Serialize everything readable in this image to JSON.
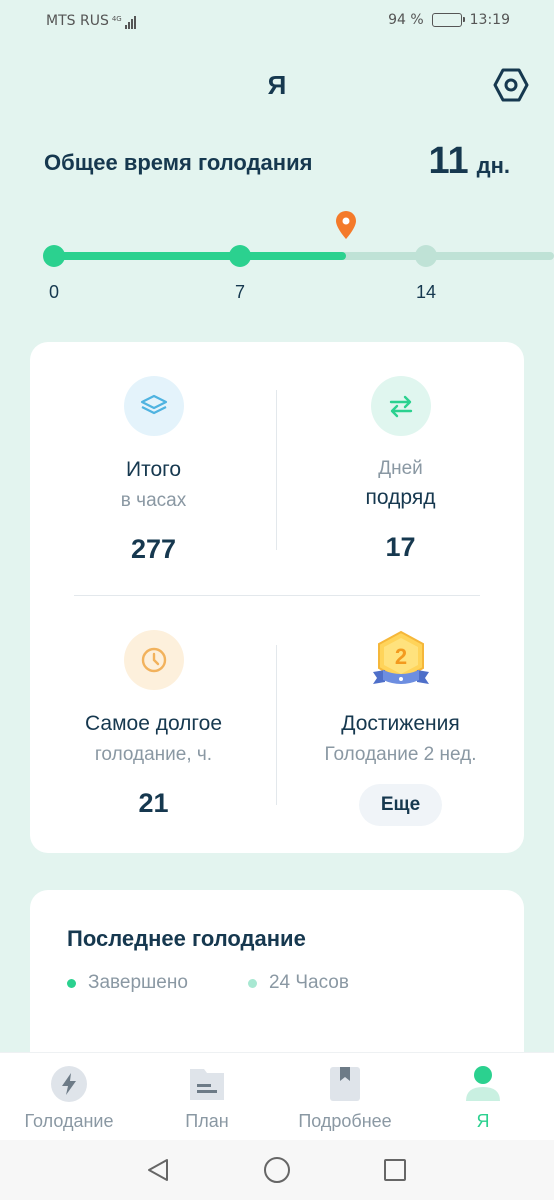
{
  "status_bar": {
    "carrier": "MTS RUS",
    "network": "4G",
    "battery": "94 %",
    "time": "13:19"
  },
  "header": {
    "title": "Я",
    "settings_icon": "hexagon-settings-icon"
  },
  "summary": {
    "label": "Общее время голодания",
    "value": "11",
    "unit": "дн."
  },
  "timeline": {
    "ticks": [
      "0",
      "7",
      "14"
    ],
    "progress_days": 11,
    "max_days": 21,
    "colors": {
      "done": "#2bd18f",
      "future": "#bfe2d6",
      "marker": "#f47a2a"
    }
  },
  "stats": {
    "total": {
      "title": "Итого",
      "subtitle": "в часах",
      "value": "277",
      "icon": "layers-icon"
    },
    "streak": {
      "muted": "Дней",
      "title": "подряд",
      "value": "17",
      "icon": "swap-arrows-icon"
    },
    "longest": {
      "title": "Самое долгое",
      "subtitle": "голодание, ч.",
      "value": "21",
      "icon": "clock-icon"
    },
    "achievements": {
      "title": "Достижения",
      "subtitle": "Голодание 2 нед.",
      "badge": "2",
      "button": "Еще",
      "icon": "medal-icon"
    }
  },
  "last_fast": {
    "title": "Последнее голодание",
    "legend": [
      {
        "label": "Завершено",
        "color": "#2bd18f"
      },
      {
        "label": "24 Часов",
        "color": "#a8e8d2"
      }
    ]
  },
  "bottom_nav": {
    "items": [
      {
        "label": "Голодание",
        "icon": "lightning-icon",
        "active": false
      },
      {
        "label": "План",
        "icon": "plan-icon",
        "active": false
      },
      {
        "label": "Подробнее",
        "icon": "bookmark-icon",
        "active": false
      },
      {
        "label": "Я",
        "icon": "profile-icon",
        "active": true
      }
    ]
  },
  "accent_color": "#2bd18f"
}
